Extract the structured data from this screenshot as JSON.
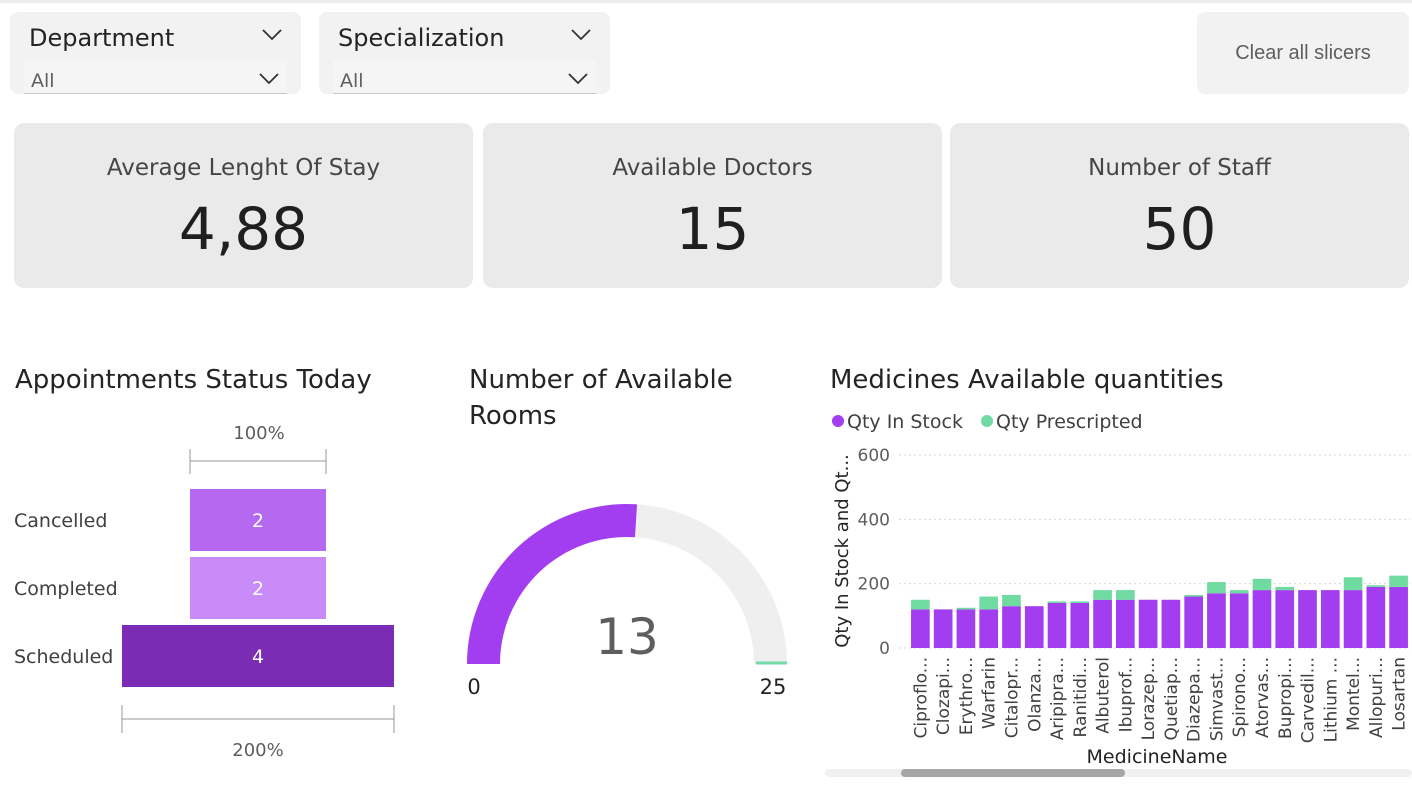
{
  "slicers": [
    {
      "title": "Department",
      "value": "All"
    },
    {
      "title": "Specialization",
      "value": "All"
    }
  ],
  "clear_button_label": "Clear all slicers",
  "kpis": [
    {
      "label": "Average Lenght Of Stay",
      "value": "4,88"
    },
    {
      "label": "Available Doctors",
      "value": "15"
    },
    {
      "label": "Number of Staff",
      "value": "50"
    }
  ],
  "appointments": {
    "title": "Appointments Status Today",
    "top_scale_label": "100%",
    "bottom_scale_label": "200%",
    "chart_data": {
      "type": "bar",
      "categories": [
        "Cancelled",
        "Completed",
        "Scheduled"
      ],
      "values": [
        2,
        2,
        4
      ],
      "colors": [
        "#b469f0",
        "#c98bf7",
        "#7b2cb5"
      ]
    }
  },
  "rooms": {
    "title_line1": "Number of Available",
    "title_line2": "Rooms",
    "value": "13",
    "min_label": "0",
    "max_label": "25",
    "chart_data": {
      "type": "gauge",
      "value": 13,
      "min": 0,
      "max": 25,
      "fill_color": "#a23ef0",
      "track_color": "#f0efef",
      "target_color": "#73d9a7"
    }
  },
  "medicines": {
    "title": "Medicines Available quantities",
    "chart_data": {
      "type": "bar",
      "stacked": true,
      "xlabel": "MedicineName",
      "ylabel": "Qty In Stock and Qt...",
      "ylim": [
        0,
        600
      ],
      "yticks": [
        0,
        200,
        400,
        600
      ],
      "grid": true,
      "legend": "top-left",
      "categories": [
        "Ciproflo...",
        "Clozapi...",
        "Erythro...",
        "Warfarin",
        "Citalopr...",
        "Olanza...",
        "Aripipra...",
        "Ranitidi...",
        "Albuterol",
        "Ibuprof...",
        "Lorazep...",
        "Quetiap...",
        "Diazepa...",
        "Simvast...",
        "Spirono...",
        "Atorvas...",
        "Bupropi...",
        "Carvedil...",
        "Lithium ...",
        "Montel...",
        "Allopuri...",
        "Losartan"
      ],
      "series": [
        {
          "name": "Qty In Stock",
          "color": "#a23ef0",
          "values": [
            120,
            120,
            120,
            120,
            130,
            130,
            140,
            140,
            150,
            150,
            150,
            150,
            160,
            170,
            170,
            180,
            180,
            180,
            180,
            180,
            190,
            190
          ]
        },
        {
          "name": "Qty Prescripted",
          "color": "#6fdba0",
          "values": [
            30,
            0,
            5,
            40,
            35,
            0,
            5,
            5,
            30,
            30,
            0,
            0,
            5,
            35,
            10,
            35,
            10,
            0,
            0,
            40,
            5,
            35
          ]
        }
      ]
    }
  }
}
